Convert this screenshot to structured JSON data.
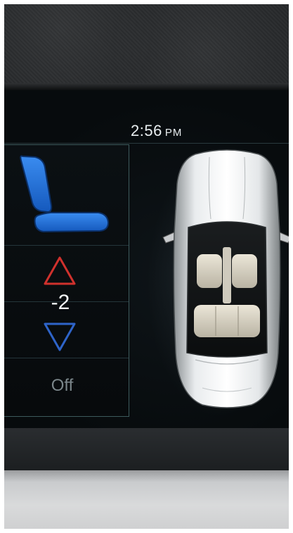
{
  "clock": {
    "time": "2:56",
    "ampm": "PM"
  },
  "seat_control": {
    "seat_icon": "seat-icon",
    "increase_icon": "triangle-up-icon",
    "decrease_icon": "triangle-down-icon",
    "level": "-2",
    "status": "Off"
  },
  "colors": {
    "seat_blue": "#1f6fd6",
    "up_arrow": "#d0312d",
    "down_arrow": "#2e64c8",
    "panel_border": "#3d5a5c"
  },
  "vehicle": {
    "image": "car-top-view"
  }
}
